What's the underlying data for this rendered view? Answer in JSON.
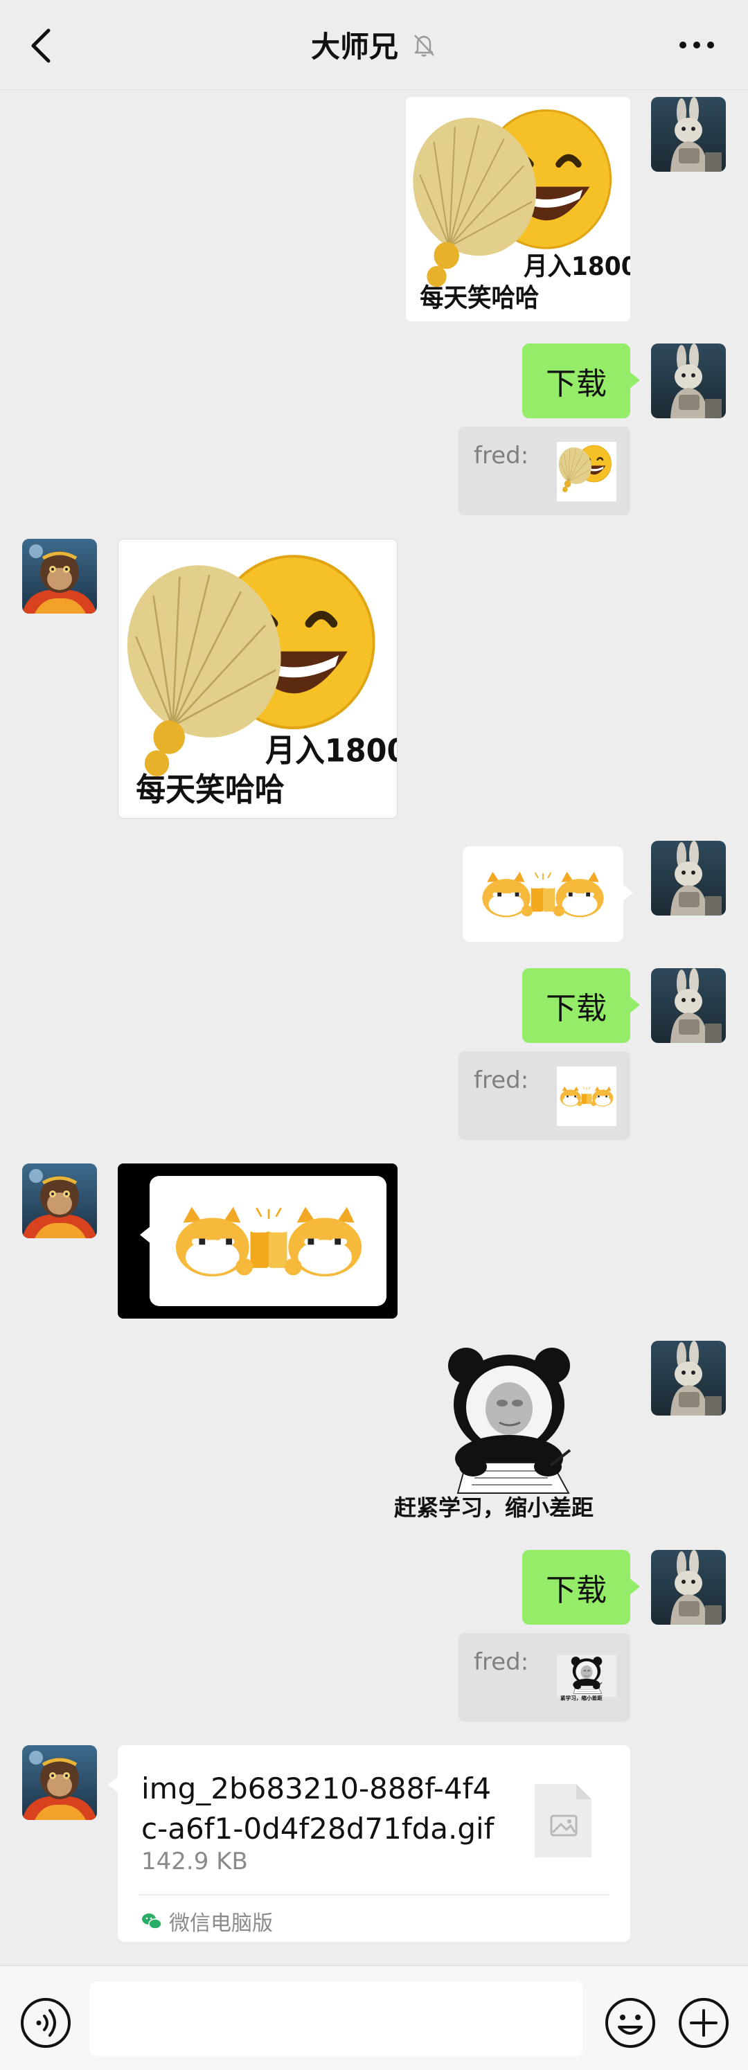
{
  "header": {
    "title": "大师兄",
    "back_icon": "chevron-left-icon",
    "mute_icon": "bell-off-icon",
    "more_icon": "more-dots-icon"
  },
  "messages": {
    "sticker_fan": {
      "line1": "月入1800",
      "line2": "每天笑哈哈"
    },
    "download_label": "下载",
    "quote_sender": "fred:",
    "sticker_panda": {
      "caption": "赶紧学习，缩小差距",
      "mini_caption": "紧学习，缩小差距"
    }
  },
  "file": {
    "name": "img_2b683210-888f-4f4c-a6f1-0d4f28d71fda.gif",
    "size": "142.9 KB",
    "source": "微信电脑版"
  },
  "colors": {
    "background": "#ededed",
    "green_bubble": "#95ec69",
    "quote_bg": "#e1e1e1"
  }
}
